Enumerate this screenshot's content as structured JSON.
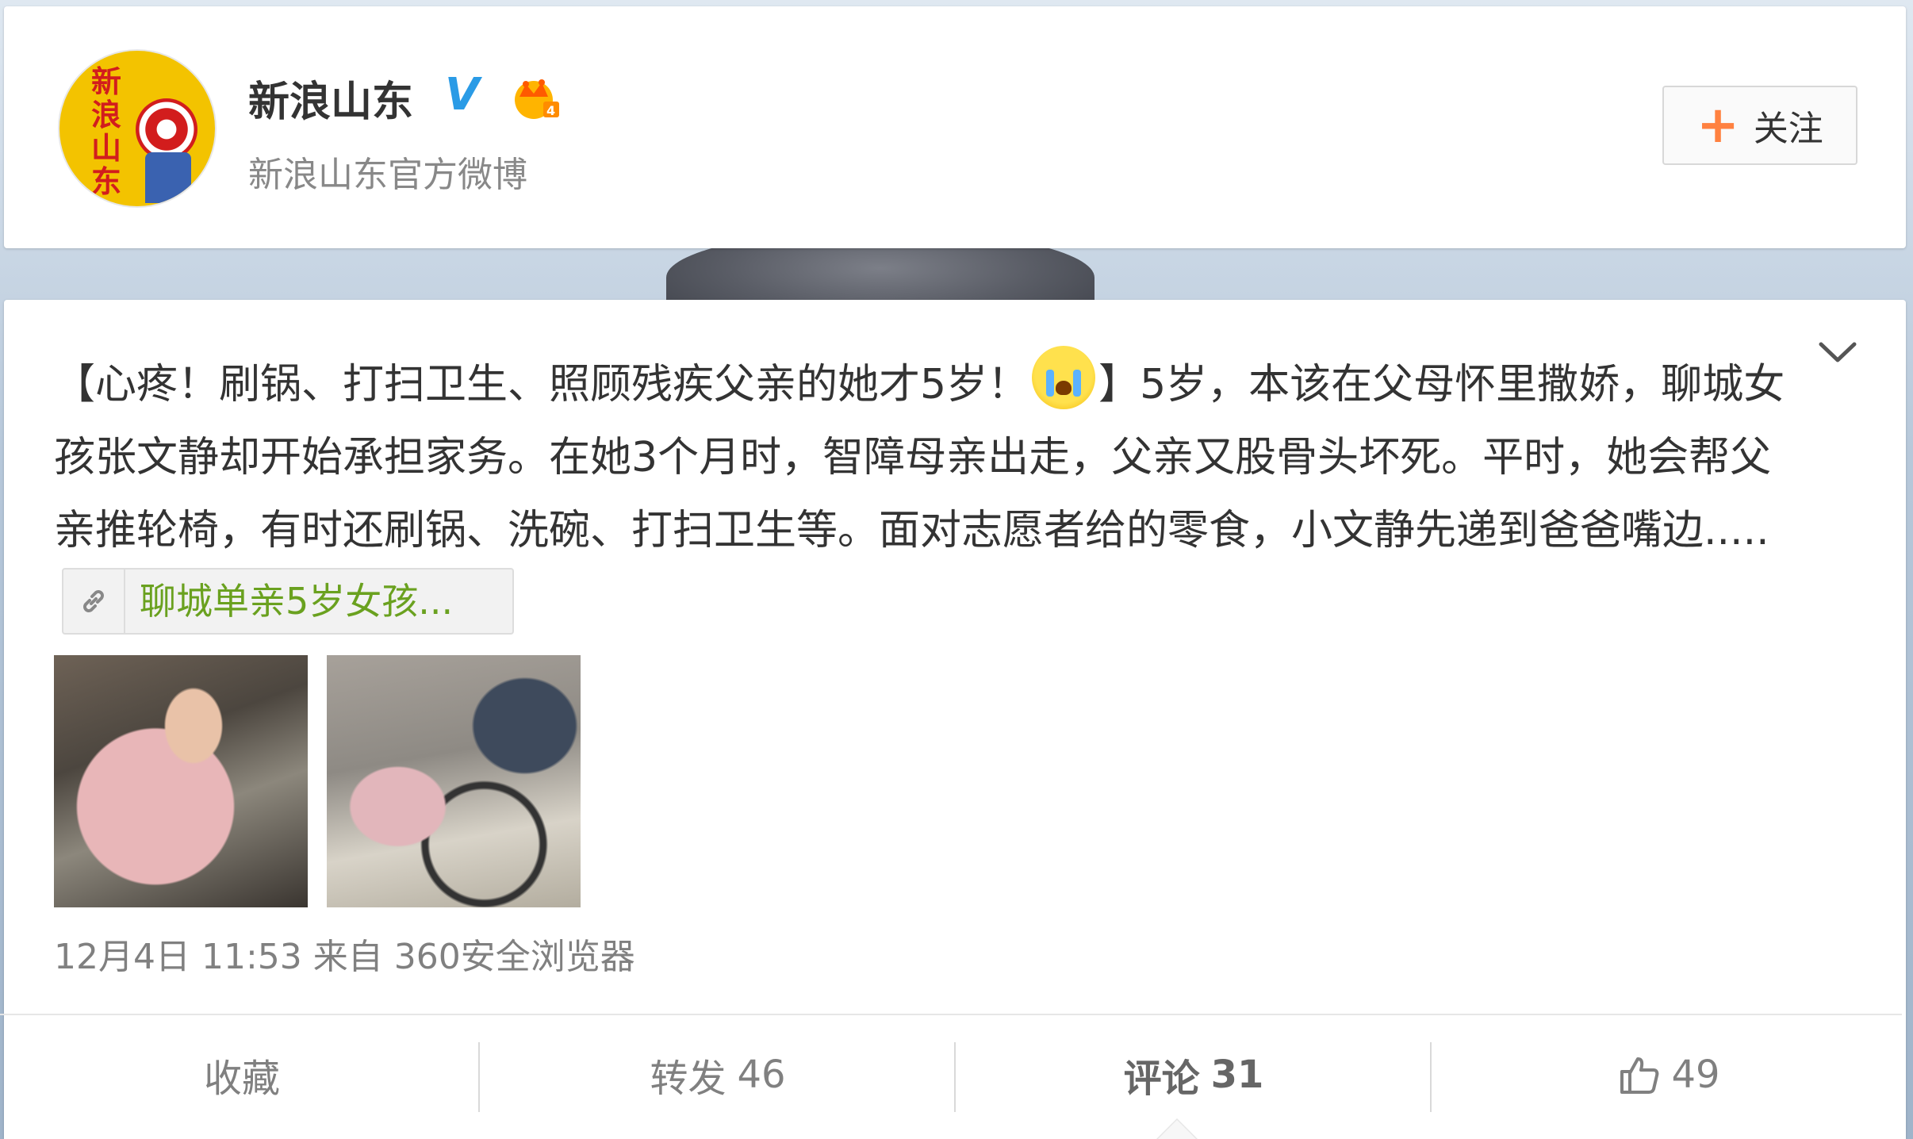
{
  "account": {
    "name": "新浪山东",
    "verified_mark": "V",
    "description": "新浪山东官方微博",
    "avatar_text": "新浪山东",
    "follow_label": "关注",
    "follow_icon": "plus-icon",
    "accent_color": "#ff8140"
  },
  "post": {
    "text_line1": "【心疼！刷锅、打扫卫生、照顾残疾父亲的她才5岁！",
    "text_line1b": "】5岁，本该在父母怀里撒娇，",
    "text_rest": "聊城女孩张文静却开始承担家务。在她3个月时，智障母亲出走，父亲又股骨头坏死。平时，她会帮父亲推轮椅，有时还刷锅、洗碗、打扫卫生等。面对志愿者给的零食，小文静先递到爸爸嘴边.....",
    "link_label": "聊城单亲5岁女孩...",
    "link_color": "#6aa11f",
    "emoji": "crying-face-icon",
    "timestamp": "12月4日 11:53",
    "source_prefix": "来自",
    "source": "360安全浏览器"
  },
  "actions": {
    "favorite": "收藏",
    "repost_label": "转发",
    "repost_count": "46",
    "comment_label": "评论",
    "comment_count": "31",
    "like_count": "49"
  }
}
